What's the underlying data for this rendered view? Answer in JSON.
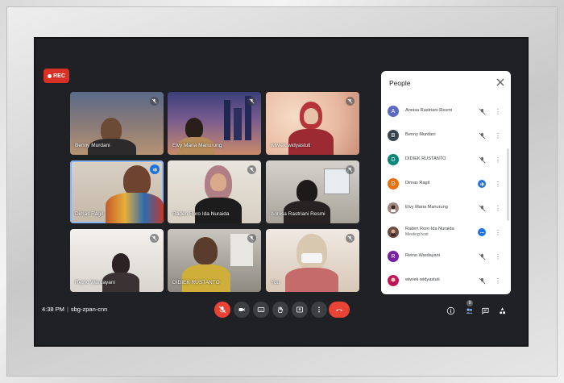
{
  "recording": {
    "label": "REC"
  },
  "tiles": [
    {
      "name": "Benny Murdani"
    },
    {
      "name": "Elvy Maria Manurung"
    },
    {
      "name": "wiwiek widyastuti"
    },
    {
      "name": "Dimas Ragil"
    },
    {
      "name": "Raden Roro Ida Nuraida"
    },
    {
      "name": "Annisa Rastriani Resmi"
    },
    {
      "name": "Retno Wardayani"
    },
    {
      "name": "DIDIEK RUSTANTO"
    },
    {
      "name": "You"
    }
  ],
  "people_panel": {
    "title": "People",
    "participants": [
      {
        "initial": "A",
        "name": "Annisa Rastriani Resmi",
        "color": "#5c6bc0"
      },
      {
        "initial": "B",
        "name": "Benny Murdani",
        "color": "#37474f"
      },
      {
        "initial": "D",
        "name": "DIDIEK RUSTANTO",
        "color": "#00897b"
      },
      {
        "initial": "D",
        "name": "Dimas Ragil",
        "color": "#e8710a"
      },
      {
        "initial": "",
        "name": "Elvy Maria Manurung",
        "color": "#a1887f"
      },
      {
        "initial": "",
        "name": "Raden Roro Ida Nuraida",
        "sub": "Meeting host",
        "color": "#6d4c41"
      },
      {
        "initial": "R",
        "name": "Retno Wardayani",
        "color": "#7b1fa2"
      },
      {
        "initial": "",
        "name": "wiwiek widyastuti",
        "color": "#c2185b"
      }
    ]
  },
  "meeting": {
    "time": "4:38 PM",
    "code": "sbg-zpan-cnn"
  },
  "people_count": "9",
  "colors": {
    "end_call": "#ea4335",
    "rec": "#d93025",
    "speaking": "#1a73e8"
  }
}
